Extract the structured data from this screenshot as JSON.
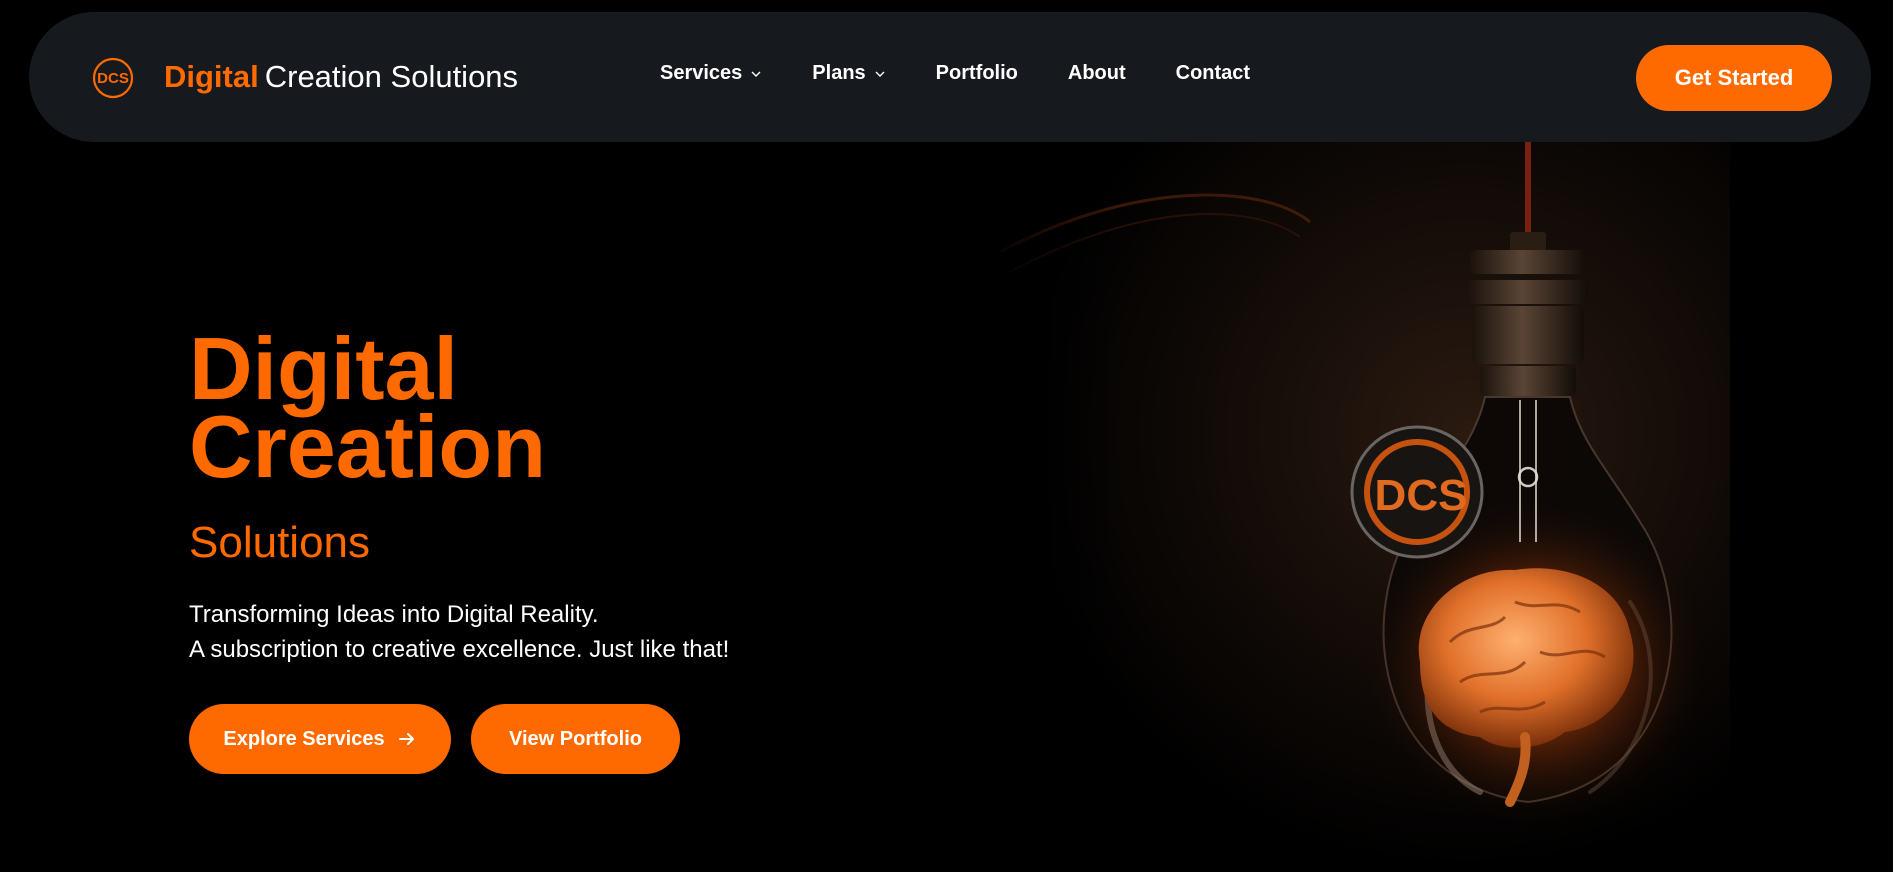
{
  "brand": {
    "logo_text": "DCS",
    "accent": "Digital",
    "rest": "Creation Solutions"
  },
  "nav": {
    "items": [
      {
        "label": "Services",
        "dropdown": true
      },
      {
        "label": "Plans",
        "dropdown": true
      },
      {
        "label": "Portfolio",
        "dropdown": false
      },
      {
        "label": "About",
        "dropdown": false
      },
      {
        "label": "Contact",
        "dropdown": false
      }
    ],
    "cta_label": "Get Started"
  },
  "hero": {
    "title_line1": "Digital",
    "title_line2": "Creation",
    "subtitle": "Solutions",
    "desc_line1": "Transforming Ideas into Digital Reality.",
    "desc_line2": "A subscription to creative excellence. Just like that!",
    "explore_label": "Explore Services",
    "portfolio_label": "View Portfolio",
    "badge_text": "DCS"
  },
  "colors": {
    "accent": "#ff6a00",
    "navbar_bg": "#16191d",
    "page_bg": "#000000"
  },
  "icons": {
    "dropdown": "chevron-down-icon",
    "explore_arrow": "arrow-right-icon"
  }
}
